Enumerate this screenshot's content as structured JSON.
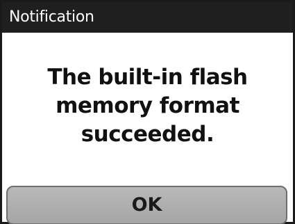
{
  "dialog": {
    "title": "Notification",
    "message_lines": [
      "The built-in flash",
      "memory format",
      "succeeded."
    ],
    "ok_label": "OK"
  }
}
